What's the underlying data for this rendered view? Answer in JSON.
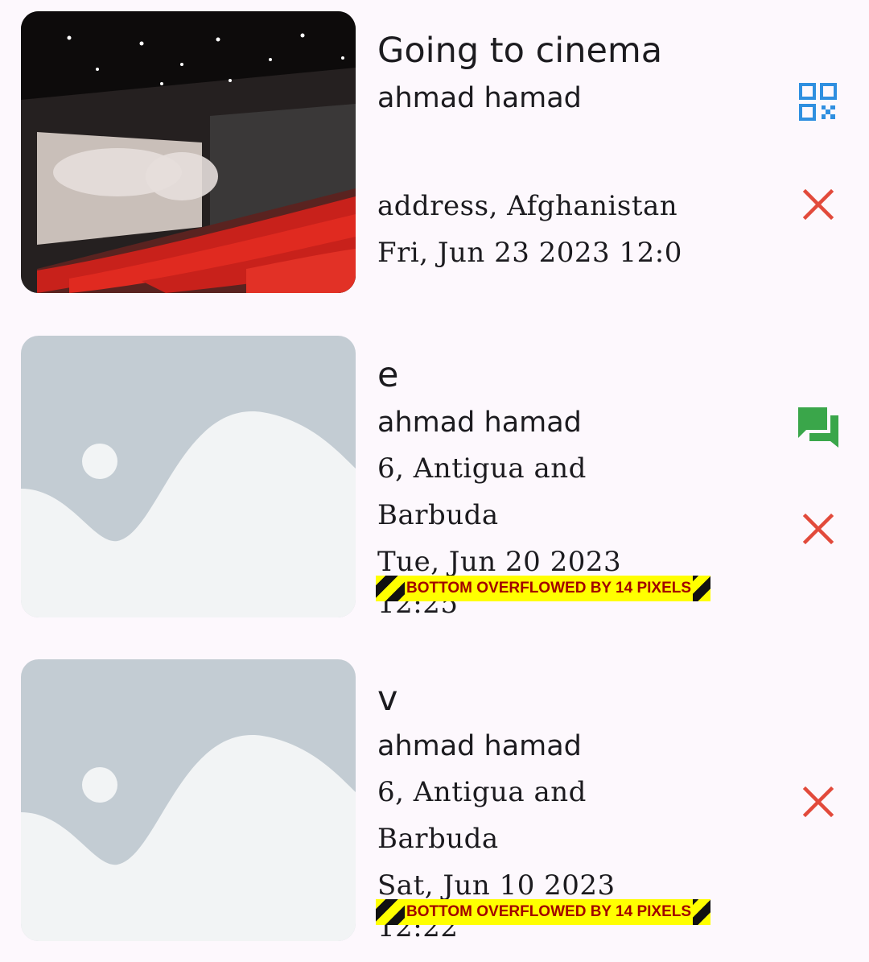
{
  "events": [
    {
      "title": "Going to cinema",
      "author": "ahmad hamad",
      "address": "address, Afghanistan",
      "date": "Fri, Jun 23 2023 12:0",
      "image": "cinema-photo",
      "actions": [
        "qr-code-icon",
        "close-icon"
      ]
    },
    {
      "title": "e",
      "author": "ahmad hamad",
      "address_line1": "6, Antigua and",
      "address_line2": "Barbuda",
      "date_line1": "Tue, Jun 20 2023",
      "date_line2": "12:25",
      "image": "image-placeholder",
      "actions": [
        "chat-icon",
        "close-icon"
      ],
      "overflow_warning": "BOTTOM OVERFLOWED BY 14 PIXELS"
    },
    {
      "title": "v",
      "author": "ahmad hamad",
      "address_line1": "6, Antigua and",
      "address_line2": "Barbuda",
      "date_line1": "Sat, Jun 10 2023",
      "date_line2": "12:22",
      "image": "image-placeholder",
      "actions": [
        "close-icon"
      ],
      "overflow_warning": "BOTTOM OVERFLOWED BY 14 PIXELS"
    }
  ],
  "colors": {
    "background": "#fdf8fd",
    "qr_icon": "#2f8fe0",
    "chat_icon": "#3aa64a",
    "close_icon": "#e24a3b",
    "placeholder_bg": "#c3ccd3",
    "placeholder_fg": "#f2f4f5"
  }
}
